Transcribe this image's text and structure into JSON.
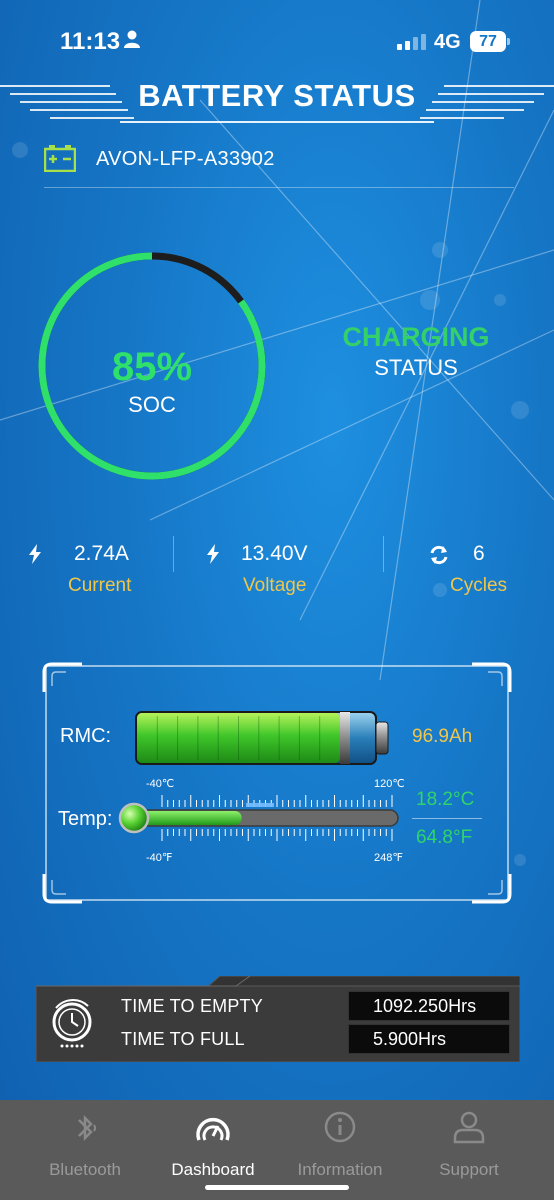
{
  "status_bar": {
    "time": "11:13",
    "network": "4G",
    "battery": "77"
  },
  "header": {
    "title": "BATTERY STATUS"
  },
  "device": {
    "name": "AVON-LFP-A33902",
    "icon": "battery-icon"
  },
  "soc": {
    "value": "85%",
    "label": "SOC",
    "fraction": 0.85
  },
  "charge": {
    "state": "CHARGING",
    "label": "STATUS"
  },
  "stats": [
    {
      "icon": "bolt-icon",
      "value": "2.74A",
      "label": "Current"
    },
    {
      "icon": "bolt-icon",
      "value": "13.40V",
      "label": "Voltage"
    },
    {
      "icon": "cycle-icon",
      "value": "6",
      "label": "Cycles"
    }
  ],
  "rmc": {
    "label": "RMC:",
    "value": "96.9Ah",
    "fill_fraction": 0.85
  },
  "temp": {
    "label": "Temp:",
    "celsius": "18.2°C",
    "fahrenheit": "64.8°F",
    "scale_c_min": "-40℃",
    "scale_c_max": "120℃",
    "scale_f_min": "-40℉",
    "scale_f_max": "248℉",
    "fill_fraction": 0.36
  },
  "times": {
    "to_empty_label": "TIME TO EMPTY",
    "to_empty_value": "1092.250Hrs",
    "to_full_label": "TIME TO FULL",
    "to_full_value": "5.900Hrs"
  },
  "nav": [
    {
      "icon": "bluetooth-icon",
      "label": "Bluetooth",
      "active": false
    },
    {
      "icon": "dashboard-icon",
      "label": "Dashboard",
      "active": true
    },
    {
      "icon": "info-icon",
      "label": "Information",
      "active": false
    },
    {
      "icon": "person-icon",
      "label": "Support",
      "active": false
    }
  ],
  "colors": {
    "accent_green": "#2fe06a",
    "label_yellow": "#f0c64a",
    "bg_blue": "#1676c6"
  }
}
